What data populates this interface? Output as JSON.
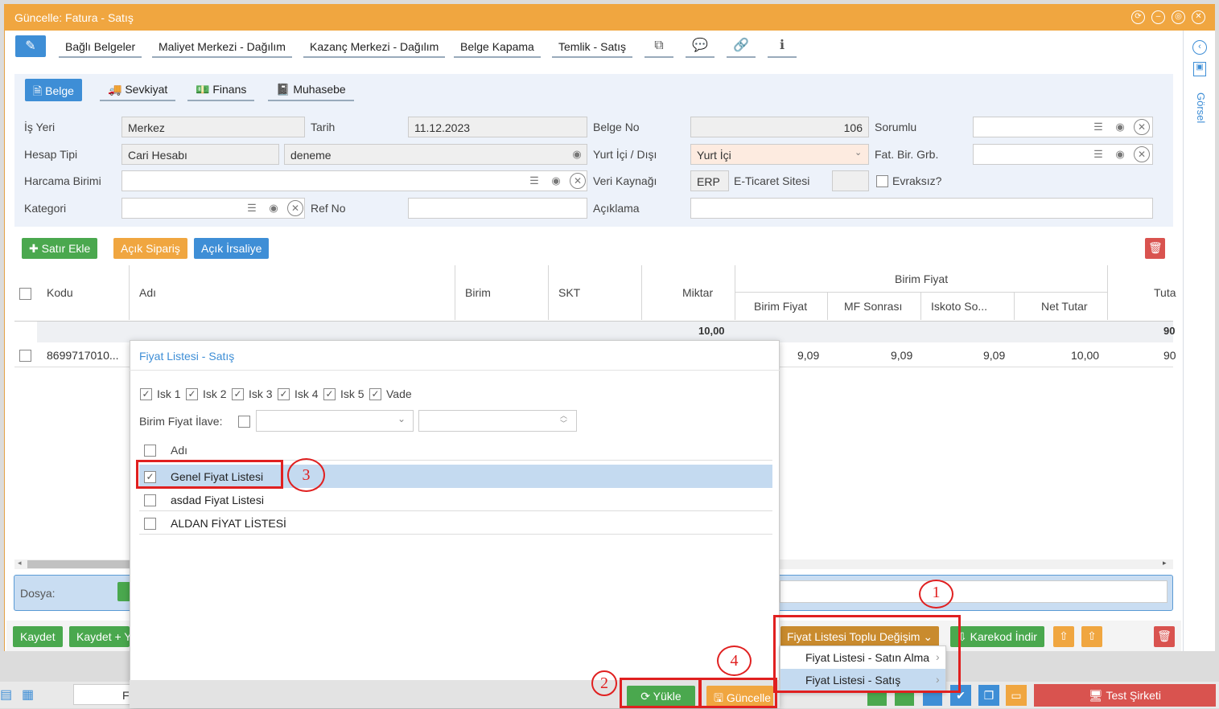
{
  "window": {
    "title": "Güncelle: Fatura - Satış"
  },
  "top_tabs": [
    "Bağlı Belgeler",
    "Maliyet Merkezi - Dağılım",
    "Kazanç Merkezi - Dağılım",
    "Belge Kapama",
    "Temlik - Satış"
  ],
  "sub_tabs": [
    "Belge",
    "Sevkiyat",
    "Finans",
    "Muhasebe"
  ],
  "right_panel": {
    "label": "Görsel"
  },
  "form": {
    "is_yeri_label": "İş Yeri",
    "is_yeri": "Merkez",
    "tarih_label": "Tarih",
    "tarih": "11.12.2023",
    "belge_no_label": "Belge No",
    "belge_no": "106",
    "sorumlu_label": "Sorumlu",
    "hesap_tipi_label": "Hesap Tipi",
    "hesap_tipi": "Cari Hesabı",
    "hesap": "deneme",
    "yurt_label": "Yurt İçi / Dışı",
    "yurt": "Yurt İçi",
    "fat_label": "Fat. Bir. Grb.",
    "harcama_label": "Harcama Birimi",
    "veri_label": "Veri Kaynağı",
    "veri": "ERP",
    "eticaret_label": "E-Ticaret Sitesi",
    "evraksiz_label": "Evraksız?",
    "kategori_label": "Kategori",
    "ref_label": "Ref No",
    "aciklama_label": "Açıklama"
  },
  "actions": {
    "satir_ekle": "Satır Ekle",
    "acik_siparis": "Açık Sipariş",
    "acik_irsaliye": "Açık İrsaliye"
  },
  "grid": {
    "headers": {
      "kodu": "Kodu",
      "adi": "Adı",
      "birim": "Birim",
      "skt": "SKT",
      "miktar": "Miktar",
      "birim_fiyat_group": "Birim Fiyat",
      "birim_fiyat": "Birim Fiyat",
      "mf_sonrasi": "MF Sonrası",
      "iskoto": "Iskoto So...",
      "net_tutar": "Net Tutar",
      "tutar": "Tuta"
    },
    "total_miktar": "10,00",
    "total_tutar": "90",
    "row": {
      "kodu": "8699717010...",
      "bf": "9,09",
      "mf": "9,09",
      "isk": "9,09",
      "net": "10,00",
      "tutar": "90"
    }
  },
  "dosya": {
    "label": "Dosya:"
  },
  "popup": {
    "title": "Fiyat Listesi - Satış",
    "checks": [
      "Isk 1",
      "Isk 2",
      "Isk 3",
      "Isk 4",
      "Isk 5",
      "Vade"
    ],
    "ilave_label": "Birim Fiyat İlave:",
    "col_adi": "Adı",
    "rows": [
      "Genel Fiyat Listesi",
      "asdad Fiyat Listesi",
      "ALDAN FİYAT LİSTESİ"
    ],
    "yukle": "Yükle",
    "guncelle": "Güncelle"
  },
  "bottom": {
    "kaydet": "Kaydet",
    "kaydet_plus": "Kaydet + Y",
    "toplu": "Fiyat Listesi Toplu Değişim",
    "karekod": "Karekod İndir"
  },
  "menu": {
    "items": [
      "Fiyat Listesi - Satın Alma",
      "Fiyat Listesi - Satış"
    ]
  },
  "annotations": [
    "1",
    "2",
    "3",
    "4"
  ],
  "taskbar": {
    "company": "Test Şirketi",
    "f_label": "F"
  }
}
